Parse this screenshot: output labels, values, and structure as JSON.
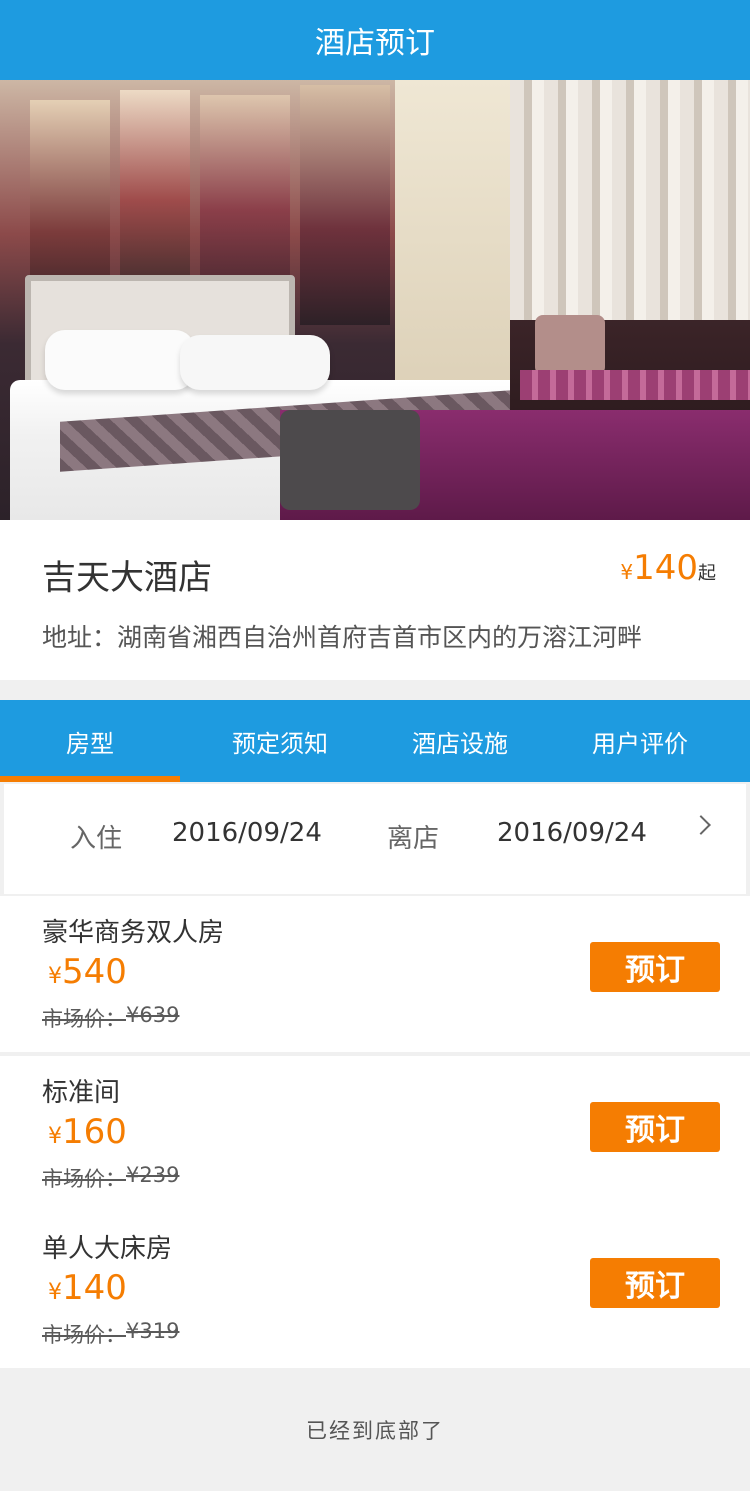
{
  "header": {
    "title": "酒店预订"
  },
  "hotel": {
    "name": "吉天大酒店",
    "price_currency": "¥",
    "price": "140",
    "price_suffix": "起",
    "address": "地址：湖南省湘西自治州首府吉首市区内的万溶江河畔"
  },
  "tabs": [
    {
      "label": "房型",
      "active": true
    },
    {
      "label": "预定须知",
      "active": false
    },
    {
      "label": "酒店设施",
      "active": false
    },
    {
      "label": "用户评价",
      "active": false
    }
  ],
  "dates": {
    "checkin_label": "入住",
    "checkin_value": "2016/09/24",
    "checkout_label": "离店",
    "checkout_value": "2016/09/24",
    "chevron_icon": "chevron-right-icon"
  },
  "rooms": [
    {
      "name": "豪华商务双人房",
      "currency": "¥",
      "price": "540",
      "market_label": "市场价：",
      "market_price": "¥639",
      "book_label": "预订"
    },
    {
      "name": "标准间",
      "currency": "¥",
      "price": "160",
      "market_label": "市场价：",
      "market_price": "¥239",
      "book_label": "预订"
    },
    {
      "name": "单人大床房",
      "currency": "¥",
      "price": "140",
      "market_label": "市场价：",
      "market_price": "¥319",
      "book_label": "预订"
    }
  ],
  "footer": {
    "text": "已经到底部了"
  },
  "colors": {
    "primary": "#1e9be0",
    "accent": "#f57d02",
    "text": "#333333",
    "muted": "#5a5a5a"
  }
}
